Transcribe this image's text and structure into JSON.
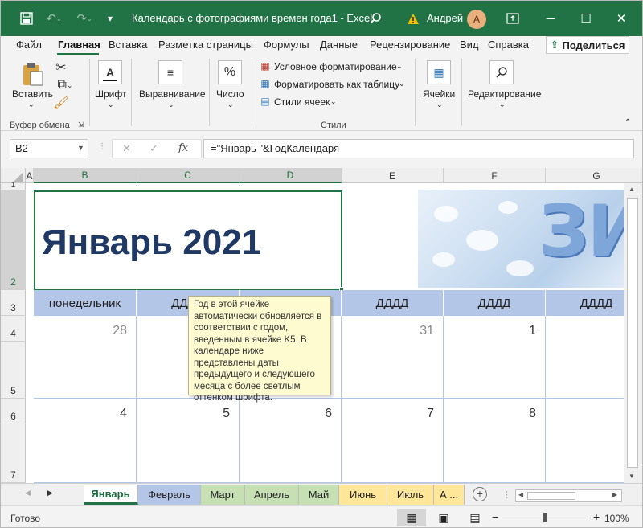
{
  "window": {
    "title": "Календарь с фотографиями времен года1  -  Excel",
    "user": "Андрей",
    "avatar_initial": "А",
    "accent": "#217346"
  },
  "menu": {
    "tabs": [
      "Файл",
      "Главная",
      "Вставка",
      "Разметка страницы",
      "Формулы",
      "Данные",
      "Рецензирование",
      "Вид",
      "Справка"
    ],
    "active": "Главная",
    "share": "Поделиться"
  },
  "ribbon": {
    "paste": "Вставить",
    "clipboard_group": "Буфер обмена",
    "font": "Шрифт",
    "alignment": "Выравнивание",
    "number": "Число",
    "conditional_formatting": "Условное форматирование",
    "format_as_table": "Форматировать как таблицу",
    "cell_styles": "Стили ячеек",
    "styles_group": "Стили",
    "cells": "Ячейки",
    "editing": "Редактирование",
    "number_icon": "%"
  },
  "formula_bar": {
    "name_box": "B2",
    "formula": "=\"Январь \"&ГодКалендаря",
    "fx": "fx"
  },
  "grid": {
    "columns": [
      "A",
      "B",
      "C",
      "D",
      "E",
      "F",
      "G"
    ],
    "rows": [
      "1",
      "2",
      "3",
      "4",
      "5",
      "6",
      "7"
    ],
    "selected_column": "B",
    "selected_row": "2"
  },
  "calendar": {
    "title": "Январь 2021",
    "banner_text": "ЗИ",
    "day_headers": [
      "понедельник",
      "ДДДД",
      "ДДДД",
      "ДДДД",
      "ДДДД",
      "ДДДД"
    ],
    "week1": [
      "28",
      "",
      "",
      "31",
      "1"
    ],
    "week2": [
      "4",
      "5",
      "6",
      "7",
      "8"
    ],
    "header_color": "#b4c6e7",
    "title_color": "#1f3864"
  },
  "tooltip": {
    "text": "Год в этой ячейке автоматически обновляется в соответствии с годом, введенным в ячейке K5. В календаре ниже представлены даты предыдущего и следующего месяца с более светлым оттенком шрифта."
  },
  "sheet_tabs": {
    "tabs": [
      {
        "label": "Январь",
        "color": "#ffffff"
      },
      {
        "label": "Февраль",
        "color": "#b4c6e7"
      },
      {
        "label": "Март",
        "color": "#c6e0b4"
      },
      {
        "label": "Апрель",
        "color": "#c6e0b4"
      },
      {
        "label": "Май",
        "color": "#c6e0b4"
      },
      {
        "label": "Июнь",
        "color": "#ffe699"
      },
      {
        "label": "Июль",
        "color": "#ffe699"
      },
      {
        "label": "А ...",
        "color": "#ffe699"
      }
    ],
    "active": "Январь"
  },
  "status": {
    "ready": "Готово",
    "zoom": "100%"
  }
}
